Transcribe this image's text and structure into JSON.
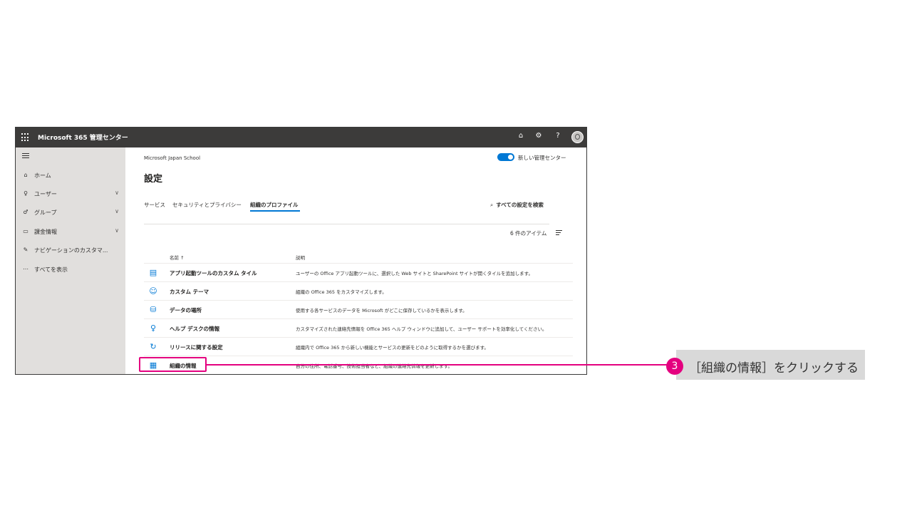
{
  "app": {
    "title": "Microsoft 365 管理センター"
  },
  "sidebar": {
    "items": [
      {
        "label": "ホーム",
        "icon": "home-icon",
        "chevron": false
      },
      {
        "label": "ユーザー",
        "icon": "user-icon",
        "chevron": true
      },
      {
        "label": "グループ",
        "icon": "group-icon",
        "chevron": true
      },
      {
        "label": "課金情報",
        "icon": "billing-icon",
        "chevron": true
      },
      {
        "label": "ナビゲーションのカスタマ...",
        "icon": "pencil-icon",
        "chevron": false
      },
      {
        "label": "すべてを表示",
        "icon": "more-icon",
        "chevron": false
      }
    ]
  },
  "main": {
    "org_name": "Microsoft Japan School",
    "toggle_label": "新しい管理センター",
    "page_title": "設定",
    "tabs": [
      {
        "label": "サービス",
        "active": false
      },
      {
        "label": "セキュリティとプライバシー",
        "active": false
      },
      {
        "label": "組織のプロファイル",
        "active": true
      }
    ],
    "search_label": "すべての設定を検索",
    "item_count": "6 件のアイテム",
    "columns": {
      "name": "名前 ↑",
      "description": "説明"
    },
    "rows": [
      {
        "name": "アプリ起動ツールのカスタム タイル",
        "description": "ユーザーの Office アプリ起動ツールに、選択した Web サイトと SharePoint サイトが開くタイルを追加します。",
        "icon": "tiles-icon"
      },
      {
        "name": "カスタム テーマ",
        "description": "組織の Office 365 をカスタマイズします。",
        "icon": "palette-icon"
      },
      {
        "name": "データの場所",
        "description": "使用する各サービスのデータを Microsoft がどこに保存しているかを表示します。",
        "icon": "database-location-icon"
      },
      {
        "name": "ヘルプ デスクの情報",
        "description": "カスタマイズされた連絡先情報を Office 365 ヘルプ ウィンドウに追加して、ユーザー サポートを効率化してください。",
        "icon": "helpdesk-icon"
      },
      {
        "name": "リリースに関する設定",
        "description": "組織内で Office 365 から新しい機能とサービスの更新をどのように取得するかを選びます。",
        "icon": "refresh-icon"
      },
      {
        "name": "組織の情報",
        "description": "自分の住所、電話番号、技術担当者など、組織の連絡先情報を更新します。",
        "icon": "org-info-icon"
      }
    ]
  },
  "callout": {
    "number": "3",
    "text": "［組織の情報］をクリックする",
    "color": "#e4007f"
  }
}
